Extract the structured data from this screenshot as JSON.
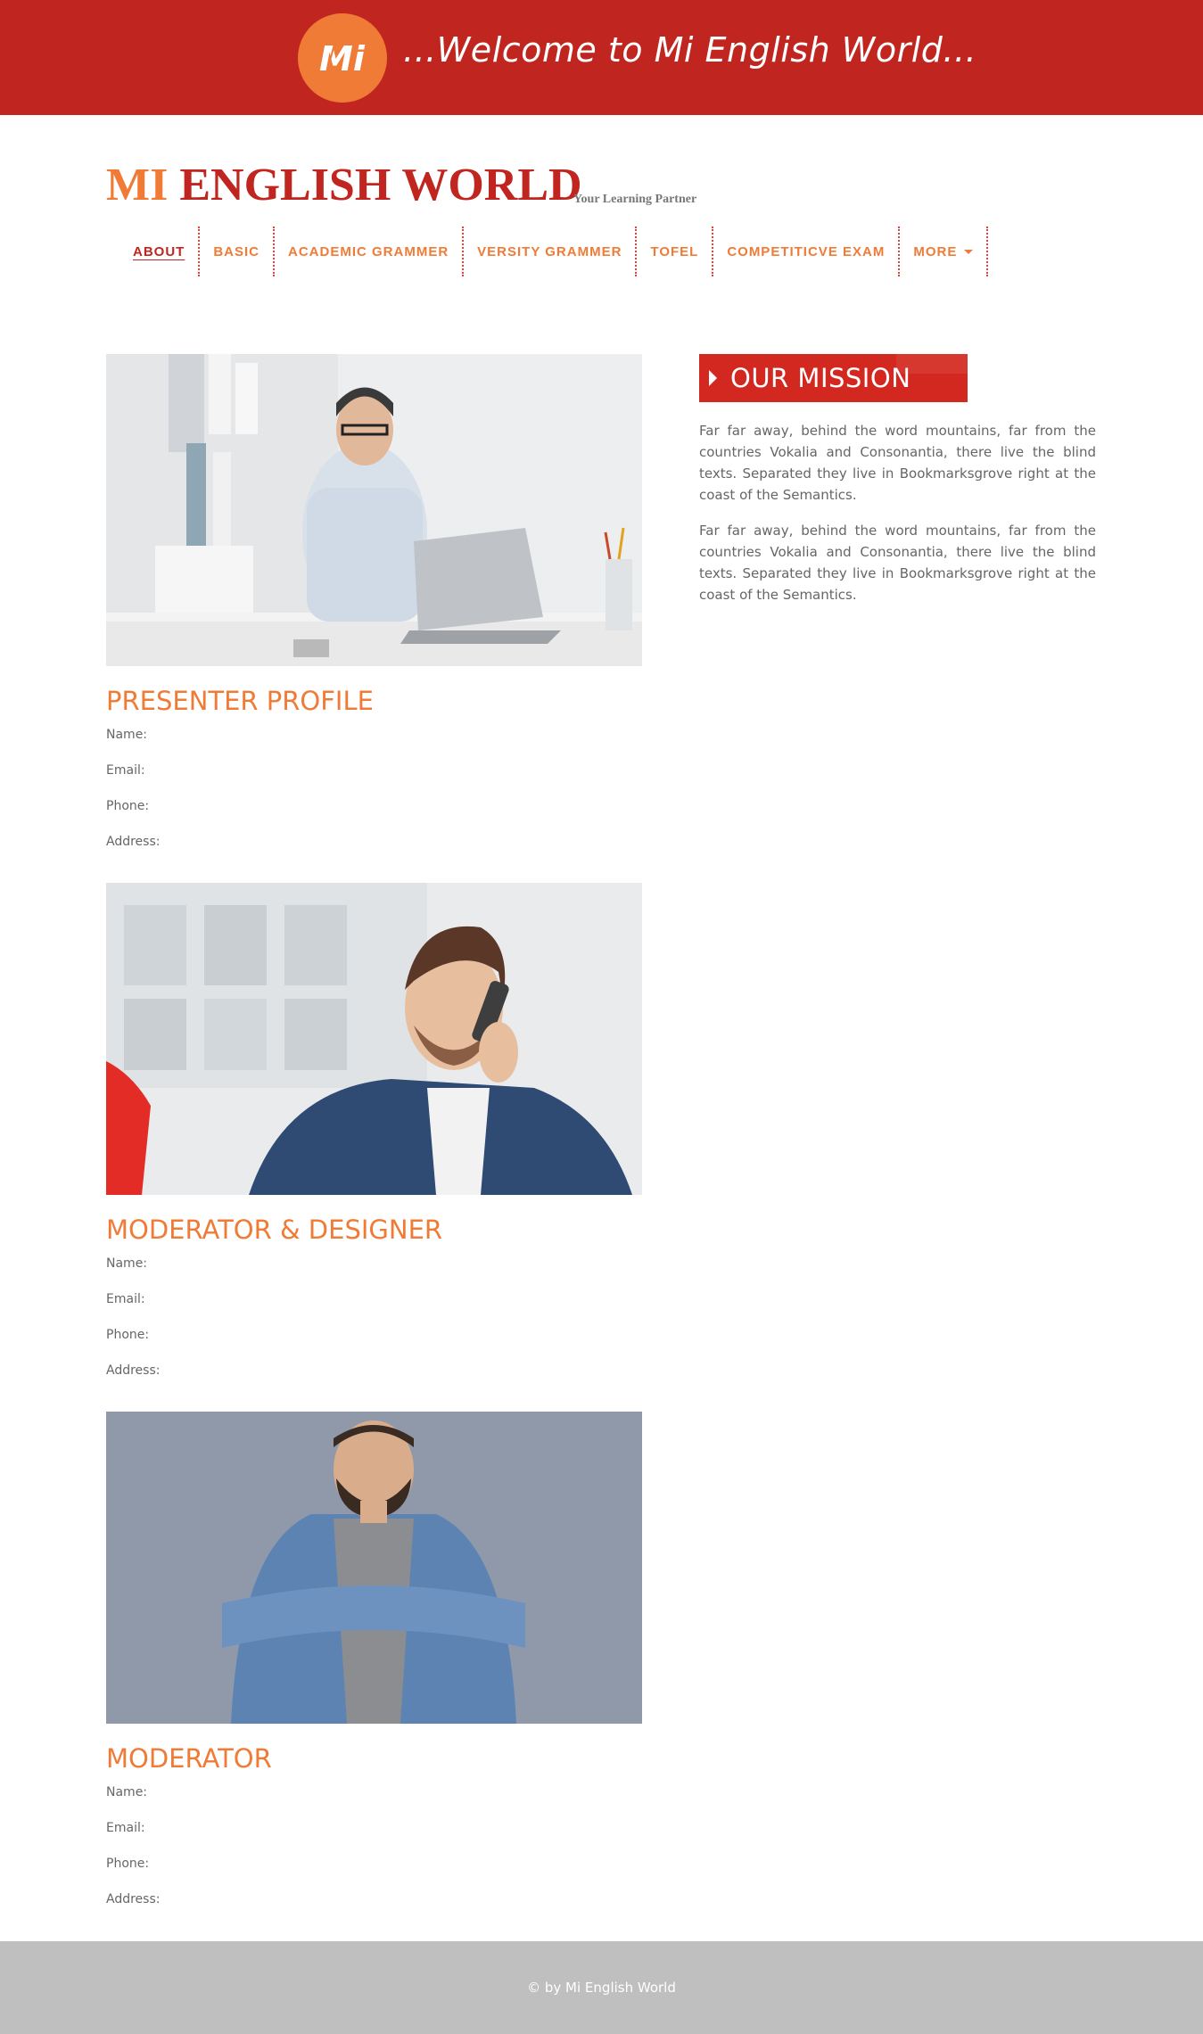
{
  "banner": {
    "welcome": "...Welcome to Mi English World...",
    "logo_text": "Mi",
    "bg_color": "#c0261f",
    "logo_color": "#f07b36"
  },
  "header": {
    "title_mi": "MI",
    "title_rest": "ENGLISH WORLD",
    "tagline": "Your Learning Partner"
  },
  "nav": {
    "items": [
      {
        "label": "ABOUT",
        "active": true
      },
      {
        "label": "BASIC"
      },
      {
        "label": "ACADEMIC GRAMMER"
      },
      {
        "label": "VERSITY GRAMMER"
      },
      {
        "label": "TOFEL"
      },
      {
        "label": "COMPETITICVE EXAM"
      },
      {
        "label": "MORE",
        "dropdown": true
      }
    ]
  },
  "profiles": [
    {
      "photo": "man-with-laptop-on-phone",
      "title": "PRESENTER PROFILE",
      "fields": [
        "Name:",
        "Email:",
        "Phone:",
        "Address:"
      ]
    },
    {
      "photo": "man-in-blazer-on-phone",
      "title": "MODERATOR & DESIGNER",
      "fields": [
        "Name:",
        "Email:",
        "Phone:",
        "Address:"
      ]
    },
    {
      "photo": "bearded-man-arms-crossed",
      "title": "MODERATOR",
      "fields": [
        "Name:",
        "Email:",
        "Phone:",
        "Address:"
      ]
    }
  ],
  "mission": {
    "title": "OUR MISSION",
    "paragraphs": [
      "Far far away, behind the word mountains, far from the countries Vokalia and Consonantia, there live the blind texts. Separated they live in Bookmarksgrove right at the coast of the Semantics.",
      "Far far away, behind the word mountains, far from the countries Vokalia and Consonantia, there live the blind texts. Separated they live in Bookmarksgrove right at the coast of the Semantics."
    ],
    "header_color": "#d3281f"
  },
  "footer": {
    "text": "© by Mi English World",
    "bg_color": "#bfbfbf"
  }
}
